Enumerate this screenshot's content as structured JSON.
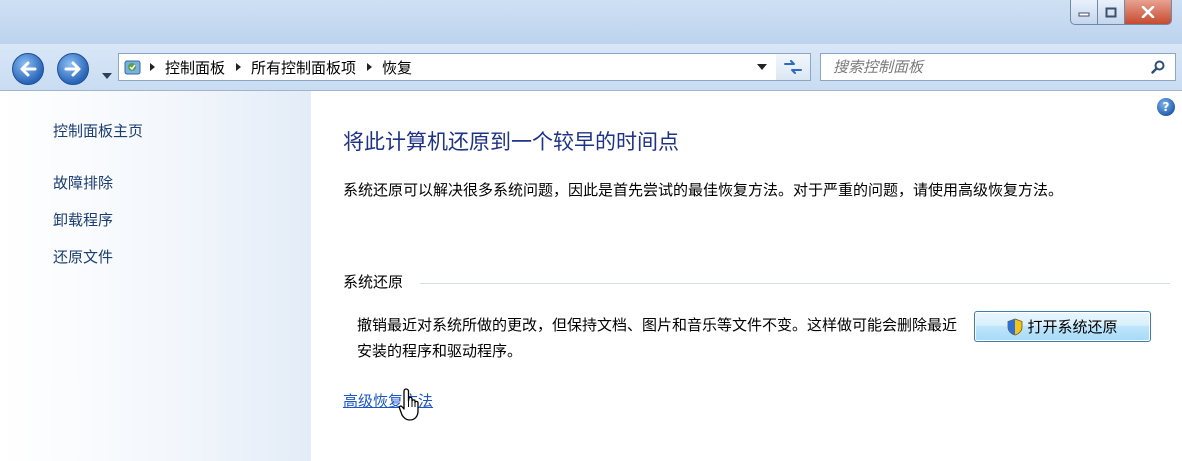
{
  "window": {
    "controls": {
      "minimize_icon": "minimize-icon",
      "maximize_icon": "maximize-icon",
      "close_icon": "close-icon"
    }
  },
  "address_bar": {
    "breadcrumbs": [
      "控制面板",
      "所有控制面板项",
      "恢复"
    ],
    "search_placeholder": "搜索控制面板"
  },
  "sidebar": {
    "items": [
      {
        "label": "控制面板主页"
      },
      {
        "label": "故障排除"
      },
      {
        "label": "卸载程序"
      },
      {
        "label": "还原文件"
      }
    ]
  },
  "main": {
    "heading": "将此计算机还原到一个较早的时间点",
    "description": "系统还原可以解决很多系统问题，因此是首先尝试的最佳恢复方法。对于严重的问题，请使用高级恢复方法。",
    "system_restore": {
      "section_title": "系统还原",
      "description": "撤销最近对系统所做的更改，但保持文档、图片和音乐等文件不变。这样做可能会删除最近安装的程序和驱动程序。",
      "button_label": "打开系统还原"
    },
    "advanced_link": "高级恢复方法"
  },
  "colors": {
    "heading": "#1e3287",
    "link": "#1b56c6",
    "sidebar_link": "#1b3d72",
    "accent": "#2865b8"
  }
}
